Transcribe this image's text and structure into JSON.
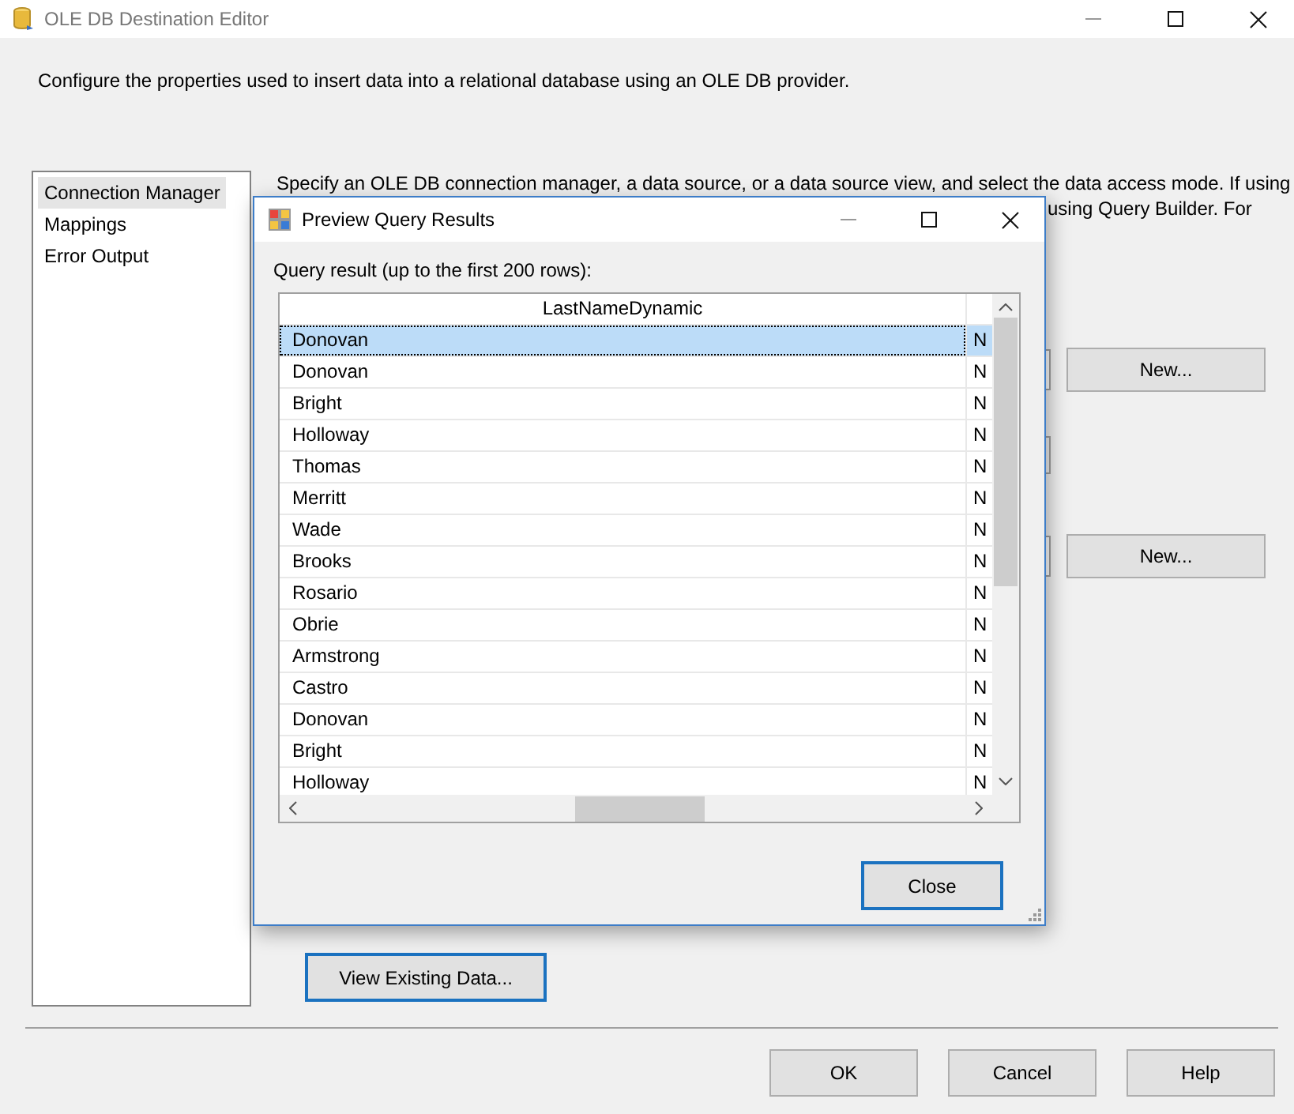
{
  "window": {
    "title": "OLE DB Destination Editor"
  },
  "header": "Configure the properties used to insert data into a relational database using an OLE DB provider.",
  "sidebar": {
    "items": [
      {
        "label": "Connection Manager",
        "selected": true
      },
      {
        "label": "Mappings",
        "selected": false
      },
      {
        "label": "Error Output",
        "selected": false
      }
    ]
  },
  "description": {
    "line_1": "Specify an OLE DB connection manager, a data source, or a data source view, and select the data access mode. If using",
    "line_2": "using Query Builder. For"
  },
  "new_buttons": [
    "New...",
    "New..."
  ],
  "view_button": "View Existing Data...",
  "buttons": [
    "OK",
    "Cancel",
    "Help"
  ],
  "dialog": {
    "title": "Preview Query Results",
    "label": "Query result (up to the first 200 rows):",
    "columns": [
      "LastNameDynamic"
    ],
    "rows": [
      {
        "cells": [
          "Donovan",
          "N"
        ],
        "selected": true
      },
      {
        "cells": [
          "Donovan",
          "N"
        ],
        "selected": false
      },
      {
        "cells": [
          "Bright",
          "N"
        ],
        "selected": false
      },
      {
        "cells": [
          "Holloway",
          "N"
        ],
        "selected": false
      },
      {
        "cells": [
          "Thomas",
          "N"
        ],
        "selected": false
      },
      {
        "cells": [
          "Merritt",
          "N"
        ],
        "selected": false
      },
      {
        "cells": [
          "Wade",
          "N"
        ],
        "selected": false
      },
      {
        "cells": [
          "Brooks",
          "N"
        ],
        "selected": false
      },
      {
        "cells": [
          "Rosario",
          "N"
        ],
        "selected": false
      },
      {
        "cells": [
          "Obrie",
          "N"
        ],
        "selected": false
      },
      {
        "cells": [
          "Armstrong",
          "N"
        ],
        "selected": false
      },
      {
        "cells": [
          "Castro",
          "N"
        ],
        "selected": false
      },
      {
        "cells": [
          "Donovan",
          "N"
        ],
        "selected": false
      },
      {
        "cells": [
          "Bright",
          "N"
        ],
        "selected": false
      },
      {
        "cells": [
          "Holloway",
          "N"
        ],
        "selected": false
      }
    ],
    "close_button": "Close"
  }
}
